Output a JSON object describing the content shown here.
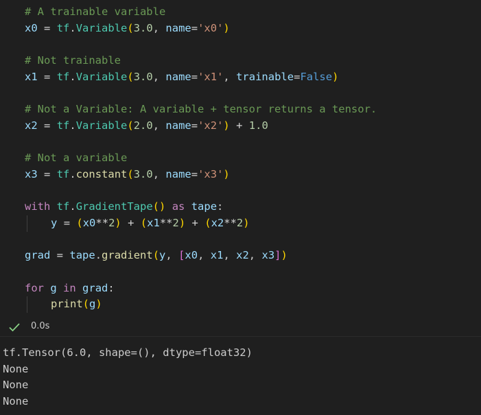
{
  "code_lines": [
    "# A trainable variable",
    "x0 = tf.Variable(3.0, name='x0')",
    "",
    "# Not trainable",
    "x1 = tf.Variable(3.0, name='x1', trainable=False)",
    "",
    "# Not a Variable: A variable + tensor returns a tensor.",
    "x2 = tf.Variable(2.0, name='x2') + 1.0",
    "",
    "# Not a variable",
    "x3 = tf.constant(3.0, name='x3')",
    "",
    "with tf.GradientTape() as tape:",
    "y = (x0**2) + (x1**2) + (x2**2)",
    "",
    "grad = tape.gradient(y, [x0, x1, x2, x3])",
    "",
    "for g in grad:",
    "print(g)"
  ],
  "execution": {
    "status_icon": "check-icon",
    "time": "0.0s"
  },
  "output_lines": [
    "tf.Tensor(6.0, shape=(), dtype=float32)",
    "None",
    "None",
    "None"
  ],
  "colors": {
    "background": "#1f1f1f",
    "comment": "#6a9955",
    "variable": "#9cdcfe",
    "module": "#4ec9b0",
    "function": "#dcdcaa",
    "number": "#b5cea8",
    "string": "#ce9178",
    "keyword": "#c586c0",
    "constant": "#569cd6",
    "bracket1": "#ffd700",
    "bracket2": "#da70d6",
    "success": "#89d185"
  }
}
